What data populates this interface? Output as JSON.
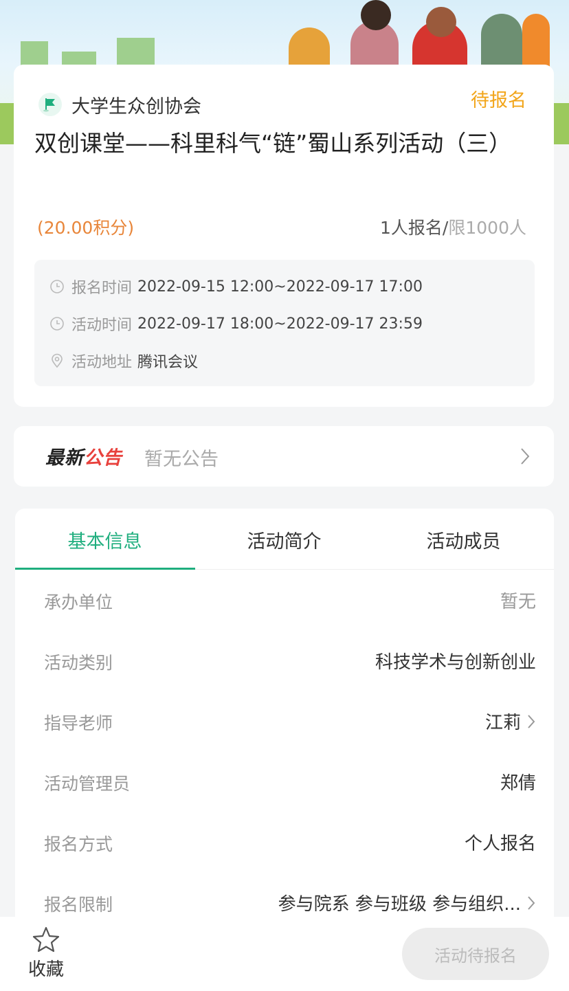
{
  "header": {
    "org_name": "大学生众创协会",
    "status": "待报名",
    "title": "双创课堂——科里科气“链”蜀山系列活动（三）",
    "points": "(20.00积分)",
    "signup_count": "1人报名/",
    "signup_limit": "限1000人"
  },
  "info": {
    "signup_time_label": "报名时间",
    "signup_time_value": "2022-09-15 12:00~2022-09-17 17:00",
    "activity_time_label": "活动时间",
    "activity_time_value": "2022-09-17 18:00~2022-09-17 23:59",
    "address_label": "活动地址",
    "address_value": "腾讯会议"
  },
  "notice": {
    "logo_part1": "最新",
    "logo_part2": "公告",
    "text": "暂无公告"
  },
  "tabs": [
    {
      "label": "基本信息",
      "active": true
    },
    {
      "label": "活动简介",
      "active": false
    },
    {
      "label": "活动成员",
      "active": false
    }
  ],
  "details": [
    {
      "key": "承办单位",
      "value": "暂无"
    },
    {
      "key": "活动类别",
      "value": "科技学术与创新创业"
    },
    {
      "key": "指导老师",
      "value": "江莉"
    },
    {
      "key": "活动管理员",
      "value": "郑倩"
    },
    {
      "key": "报名方式",
      "value": "个人报名"
    },
    {
      "key": "报名限制",
      "value": "参与院系 参与班级 参与组织..."
    }
  ],
  "bottom": {
    "favorite_label": "收藏",
    "cta_label": "活动待报名"
  },
  "colors": {
    "accent": "#1fae7e",
    "status": "#f2a51a",
    "points": "#e8863a",
    "notice_red": "#e8413c"
  },
  "icons": {
    "org": "flag-icon",
    "time": "clock-icon",
    "address": "location-pin-icon",
    "favorite": "star-icon",
    "chevron": "chevron-right-icon"
  }
}
